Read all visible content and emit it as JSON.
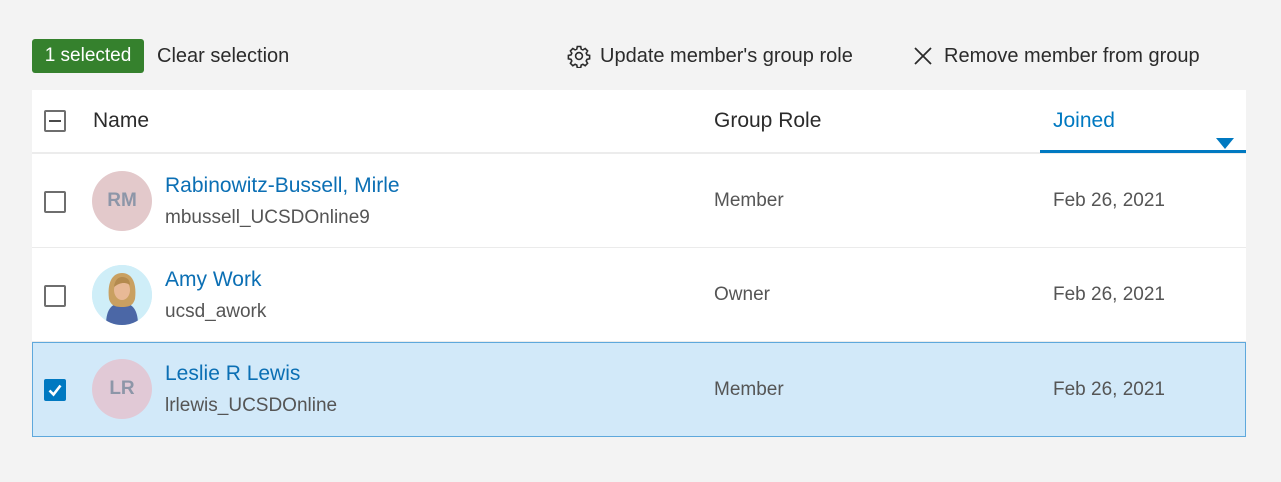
{
  "toolbar": {
    "selected_badge": "1 selected",
    "clear_selection": "Clear selection",
    "update_role": "Update member's group role",
    "remove_member": "Remove member from group"
  },
  "table": {
    "columns": {
      "name": "Name",
      "role": "Group Role",
      "joined": "Joined"
    },
    "sort": {
      "column": "Joined",
      "direction": "descending"
    },
    "rows": [
      {
        "initials": "RM",
        "name": "Rabinowitz-Bussell, Mirle",
        "username": "mbussell_UCSDOnline9",
        "role": "Member",
        "joined": "Feb 26, 2021",
        "checked": false,
        "avatar_type": "initials"
      },
      {
        "initials": "",
        "name": "Amy Work",
        "username": "ucsd_awork",
        "role": "Owner",
        "joined": "Feb 26, 2021",
        "checked": false,
        "avatar_type": "photo"
      },
      {
        "initials": "LR",
        "name": "Leslie R Lewis",
        "username": "lrlewis_UCSDOnline",
        "role": "Member",
        "joined": "Feb 26, 2021",
        "checked": true,
        "avatar_type": "initials"
      }
    ]
  },
  "colors": {
    "badge": "#35812d",
    "accent": "#0079c1",
    "selected_row": "#d2e9f9",
    "background": "#f3f3f3"
  }
}
